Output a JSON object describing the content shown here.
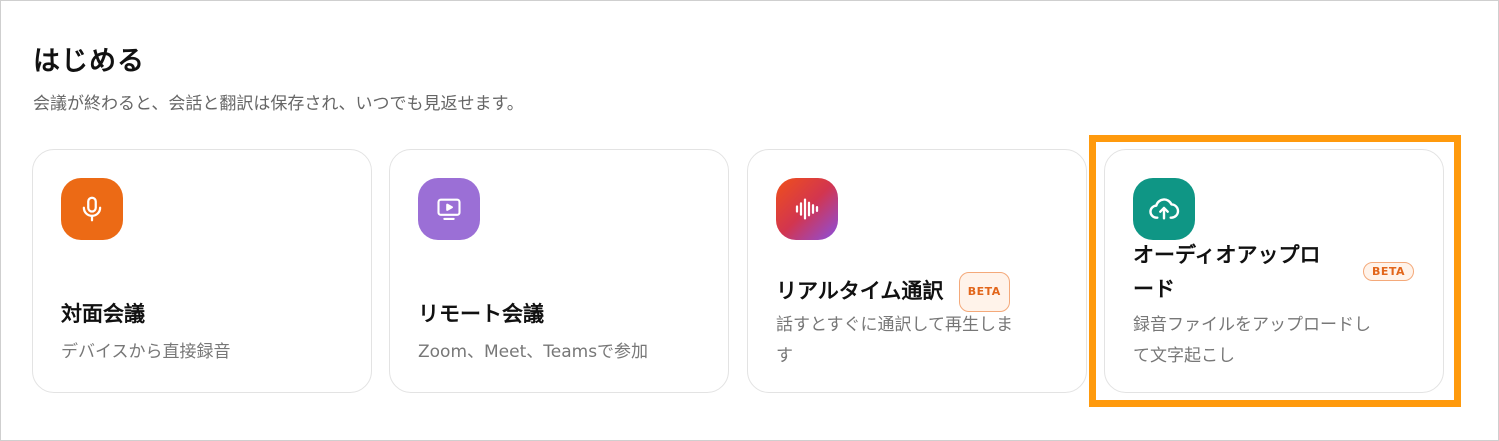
{
  "header": {
    "title": "はじめる",
    "subtitle": "会議が終わると、会話と翻訳は保存され、いつでも見返せます。"
  },
  "cards": [
    {
      "title": "対面会議",
      "description": "デバイスから直接録音",
      "icon": "microphone-icon",
      "icon_color": "#ec6a15",
      "badge": ""
    },
    {
      "title": "リモート会議",
      "description": "Zoom、Meet、Teamsで参加",
      "icon": "screen-play-icon",
      "icon_color": "#9b6fd6",
      "badge": ""
    },
    {
      "title": "リアルタイム通訳",
      "description_line1": "話すとすぐに通訳して再生しま",
      "description_line2": "す",
      "icon": "waveform-icon",
      "icon_color_start": "#f0501a",
      "icon_color_end": "#8a4fe0",
      "badge": "BETA"
    },
    {
      "title_line1": "オーディオアップロ",
      "title_line2": "ード",
      "description_line1": "録音ファイルをアップロードし",
      "description_line2": "て文字起こし",
      "icon": "cloud-upload-icon",
      "icon_color": "#0f9685",
      "badge": "BETA"
    }
  ],
  "highlight_color": "#ff9a0d"
}
